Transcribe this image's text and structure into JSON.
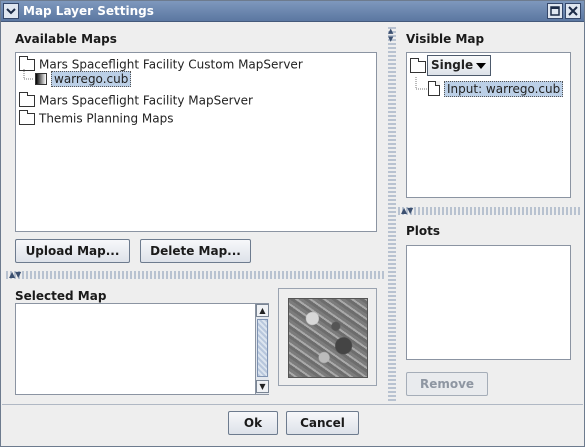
{
  "window": {
    "title": "Map Layer Settings"
  },
  "available_maps": {
    "title": "Available Maps",
    "items": [
      {
        "label": "Mars Spaceflight Facility Custom MapServer",
        "icon": "folder-icon"
      },
      {
        "label": "warrego.cub",
        "icon": "grayscale-map-icon",
        "selected": true
      },
      {
        "label": "Mars Spaceflight Facility MapServer",
        "icon": "folder-icon"
      },
      {
        "label": "Themis Planning Maps",
        "icon": "folder-icon"
      }
    ],
    "upload_label": "Upload Map...",
    "delete_label": "Delete Map..."
  },
  "selected_map": {
    "title": "Selected Map",
    "text": ""
  },
  "visible_map": {
    "title": "Visible Map",
    "mode": "Single",
    "layer": "Input: warrego.cub"
  },
  "plots": {
    "title": "Plots",
    "remove_label": "Remove"
  },
  "footer": {
    "ok_label": "Ok",
    "cancel_label": "Cancel"
  },
  "colors": {
    "titlebar": "#6a86b0",
    "selection": "#bcd0e7",
    "panel": "#eeeeee"
  }
}
